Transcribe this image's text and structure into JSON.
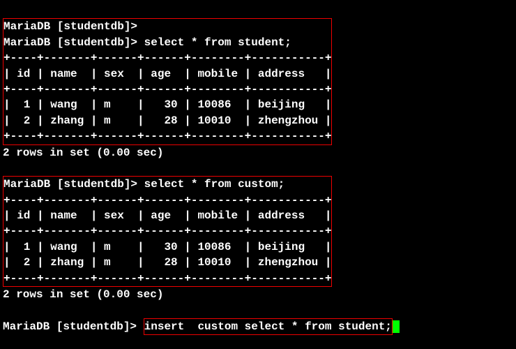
{
  "prompt_prefix": "MariaDB [studentdb]>",
  "queries": {
    "q1": "select * from student;",
    "q2": "select * from custom;",
    "q3": "insert  custom select * from student;"
  },
  "table_header": {
    "sep": "+----+-------+------+------+--------+-----------+",
    "cols": "| id | name  | sex  | age  | mobile | address   |"
  },
  "rows": {
    "r1": "|  1 | wang  | m    |   30 | 10086  | beijing   |",
    "r2": "|  2 | zhang | m    |   28 | 10010  | zhengzhou |"
  },
  "status": "2 rows in set (0.00 sec)",
  "table_data": [
    {
      "id": 1,
      "name": "wang",
      "sex": "m",
      "age": 30,
      "mobile": "10086",
      "address": "beijing"
    },
    {
      "id": 2,
      "name": "zhang",
      "sex": "m",
      "age": 28,
      "mobile": "10010",
      "address": "zhengzhou"
    }
  ]
}
